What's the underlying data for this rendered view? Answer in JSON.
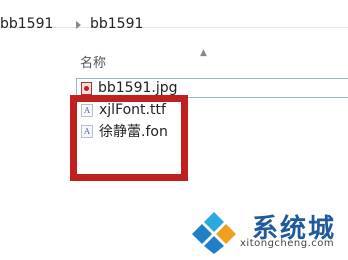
{
  "breadcrumb": {
    "items": [
      "bb1591",
      "bb1591"
    ]
  },
  "column_header": {
    "name_label": "名称",
    "sort_icon": "sort-up-arrow"
  },
  "files": [
    {
      "name": "bb1591.jpg",
      "icon": "jpg-image-icon",
      "selected": true
    },
    {
      "name": "xjlFont.ttf",
      "icon": "font-file-icon",
      "selected": false
    },
    {
      "name": "徐静蕾.fon",
      "icon": "font-file-icon",
      "selected": false
    }
  ],
  "highlight": {
    "color": "#c0201e"
  },
  "watermark": {
    "brand_cn": "系统城",
    "brand_en": "xitongcheng.com"
  }
}
